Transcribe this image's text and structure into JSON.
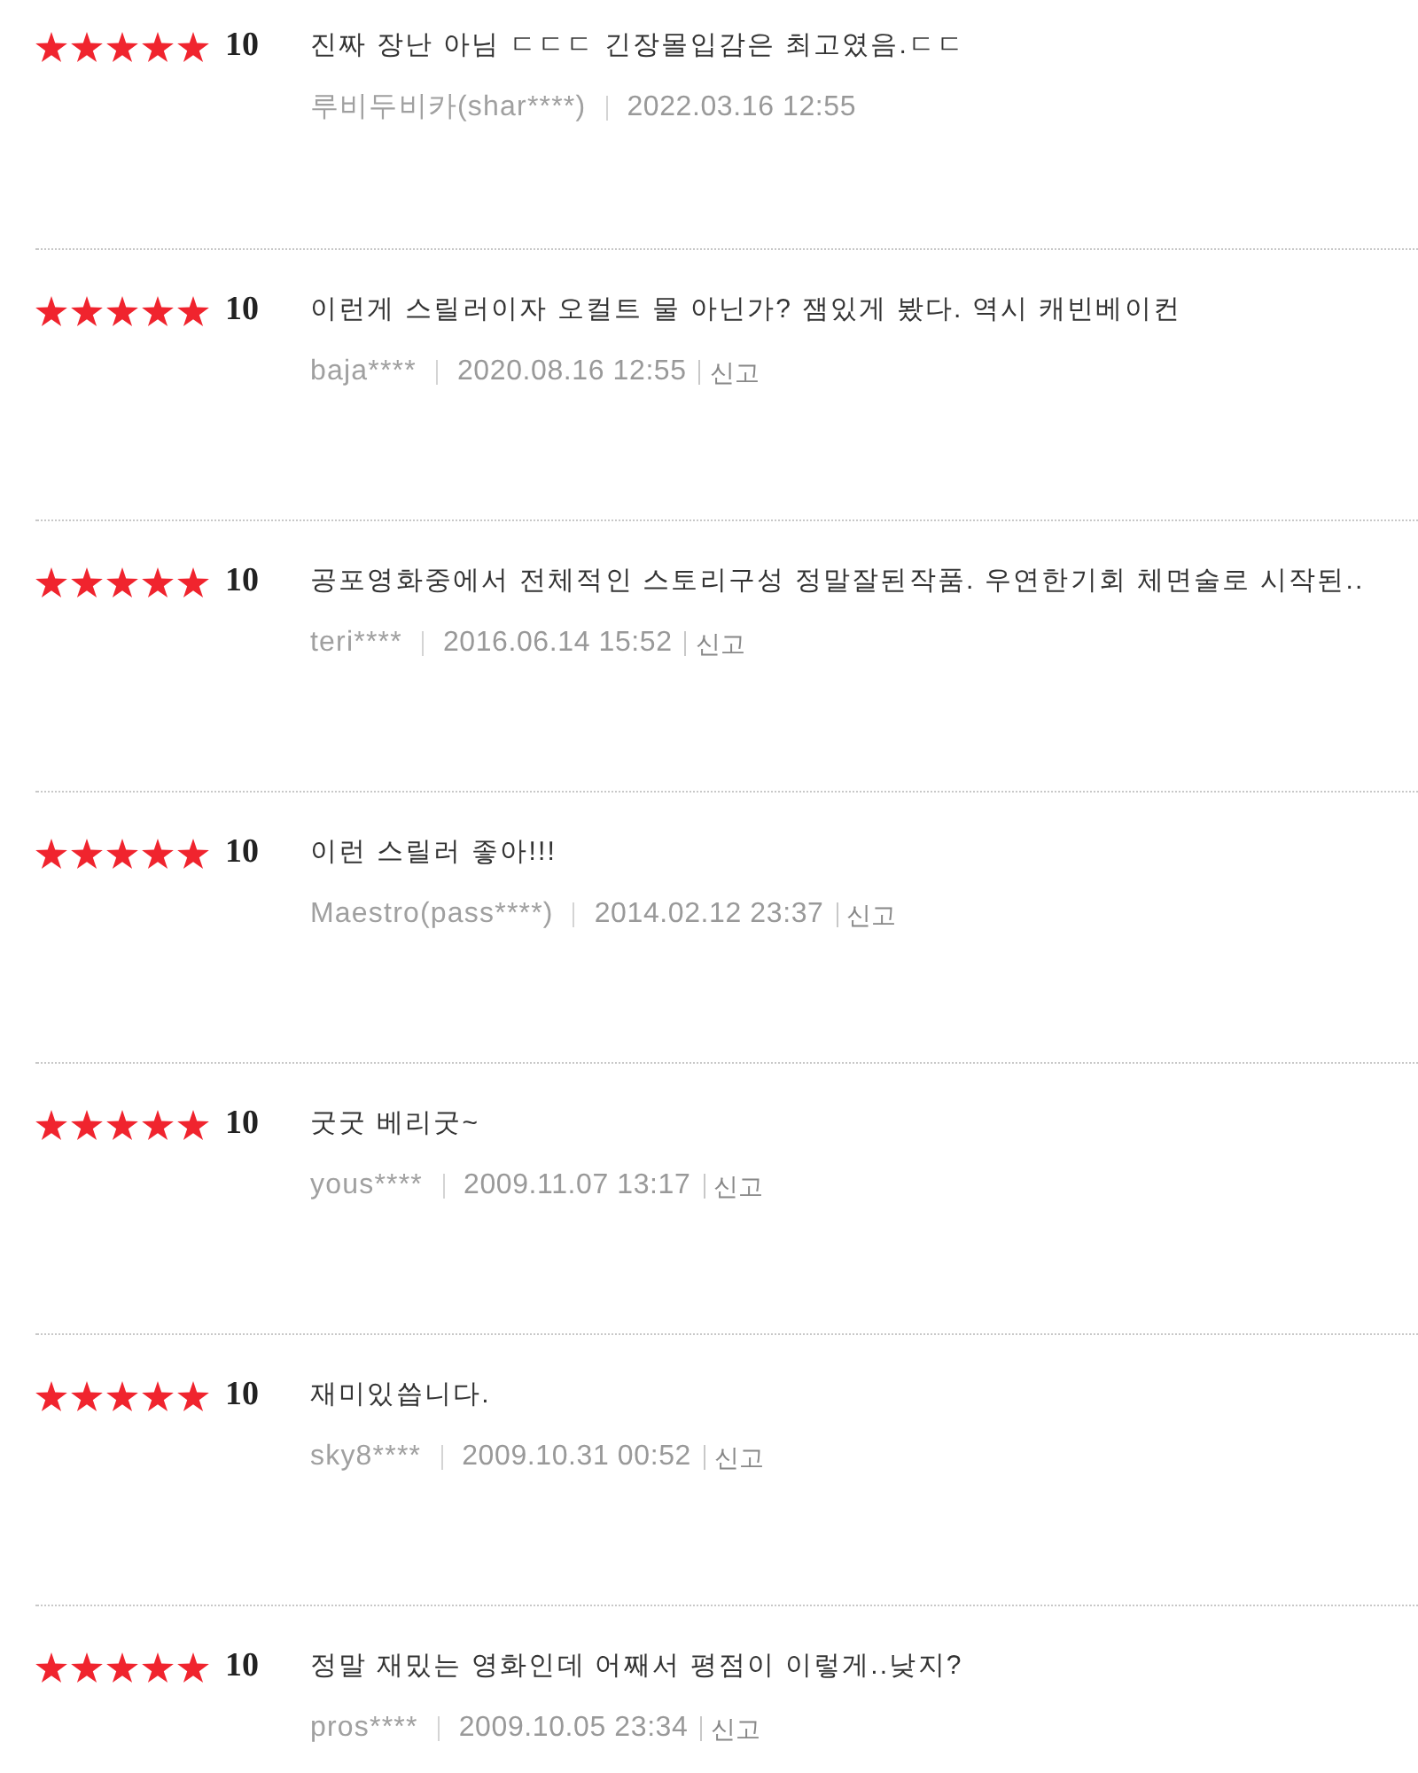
{
  "reviews": [
    {
      "stars": 5,
      "score": "10",
      "text": "진짜 장난 아님 ㄷㄷㄷ 긴장몰입감은 최고였음.ㄷㄷ",
      "author": "루비두비카(shar****)",
      "date": "2022.03.16 12:55"
    },
    {
      "stars": 5,
      "score": "10",
      "text": "이런게 스릴러이자 오컬트 물 아닌가? 잼있게 봤다. 역시 캐빈베이컨",
      "author": "baja****",
      "date": "2020.08.16 12:55",
      "report": "신고"
    },
    {
      "stars": 5,
      "score": "10",
      "text": "공포영화중에서 전체적인 스토리구성 정말잘된작품. 우연한기회 체면술로 시작된..",
      "author": "teri****",
      "date": "2016.06.14 15:52",
      "report": "신고"
    },
    {
      "stars": 5,
      "score": "10",
      "text": "이런 스릴러 좋아!!!",
      "author": "Maestro(pass****)",
      "date": "2014.02.12 23:37",
      "report": "신고"
    },
    {
      "stars": 5,
      "score": "10",
      "text": "굿굿 베리굿~",
      "author": "yous****",
      "date": "2009.11.07 13:17",
      "report": "신고"
    },
    {
      "stars": 5,
      "score": "10",
      "text": "재미있씁니다.",
      "author": "sky8****",
      "date": "2009.10.31 00:52",
      "report": "신고"
    },
    {
      "stars": 5,
      "score": "10",
      "text": "정말 재밌는 영화인데 어째서 평점이 이렇게..낮지?",
      "author": "pros****",
      "date": "2009.10.05 23:34",
      "report": "신고"
    }
  ]
}
